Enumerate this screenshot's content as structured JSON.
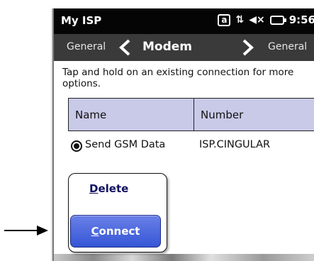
{
  "statusbar": {
    "app_title": "My ISP",
    "clock": "9:56",
    "icons": [
      "a-keyboard-icon",
      "data-arrows-icon",
      "speaker-muted-icon",
      "battery-charging-icon"
    ]
  },
  "navbar": {
    "prev_label": "General",
    "title": "Modem",
    "next_label": "General"
  },
  "hint_text": "Tap and hold on an existing connection for more options.",
  "table": {
    "columns": [
      "Name",
      "Number"
    ],
    "rows": [
      {
        "name": "Send GSM Data",
        "number": "ISP.CINGULAR",
        "selected": true
      }
    ]
  },
  "context_menu": {
    "delete_underline": "D",
    "delete_rest": "elete",
    "connect_underline": "C",
    "connect_rest": "onnect"
  },
  "colors": {
    "header_bg": "#050505",
    "navbar_bg": "#3a3a3a",
    "table_header_bg": "#c9c9e8",
    "connect_button": "#3556d6"
  }
}
